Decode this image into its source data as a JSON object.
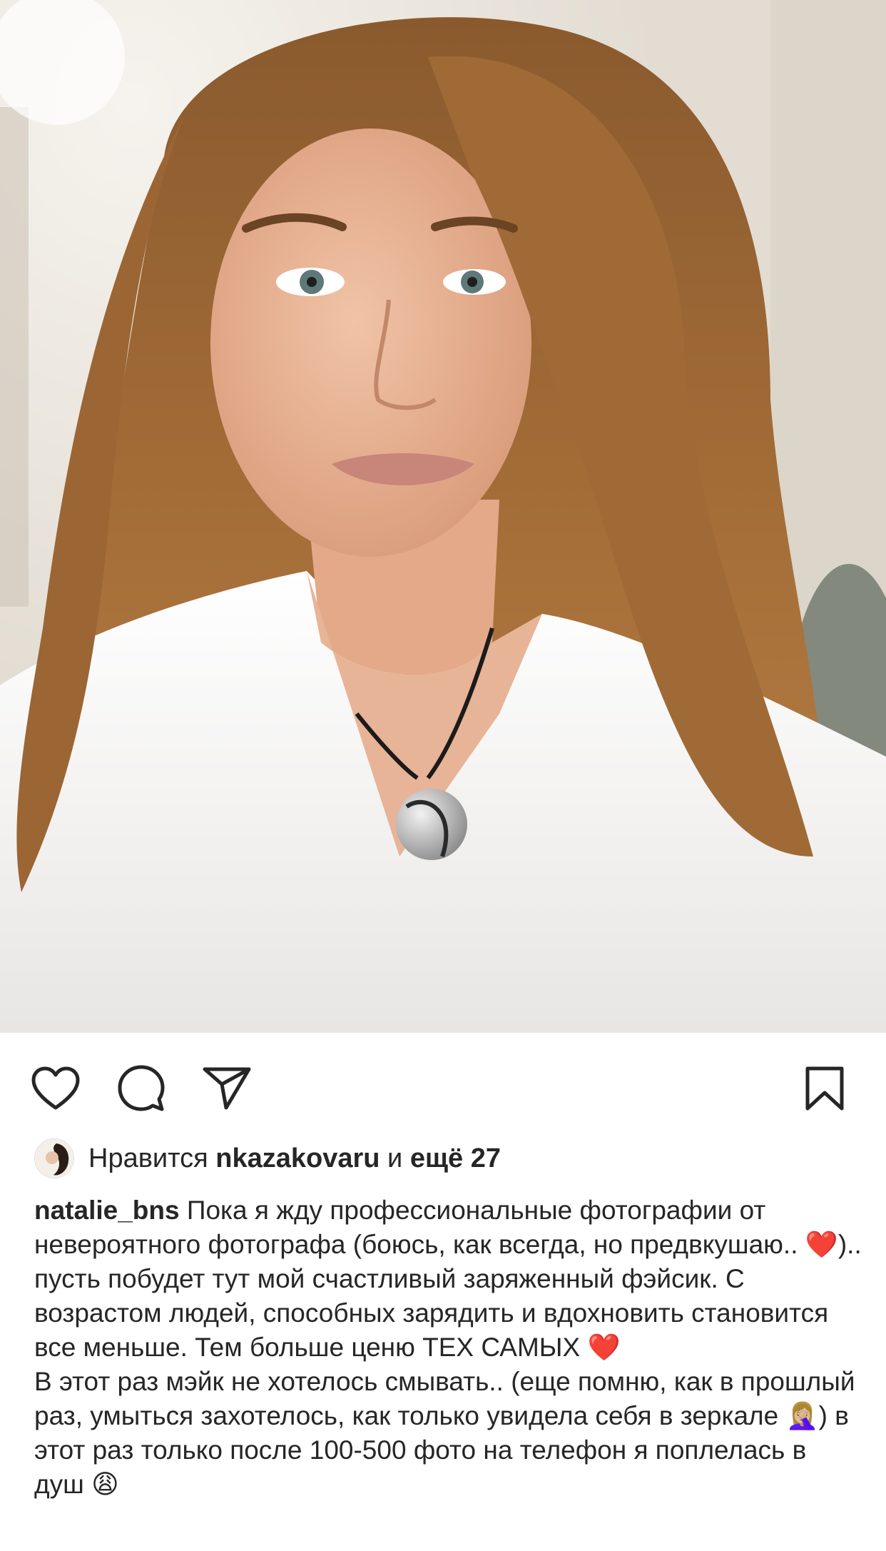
{
  "post": {
    "photo_alt": "selfie photo",
    "likes": {
      "prefix": "Нравится",
      "user": "nkazakovaru",
      "conjunction": "и",
      "others": "ещё 27"
    },
    "caption": {
      "username": "natalie_bns",
      "part1": "Пока я жду профессиональные фотографии от невероятного фотографа (боюсь, как всегда, но предвкушаю.. ",
      "heart1": "❤️",
      "part2": ").. пусть побудет тут мой счастливый заряженный фэйсик. С возрастом людей, способных зарядить и вдохновить становится все меньше. Тем больше ценю ТЕХ САМЫХ ",
      "heart2": "❤️",
      "para2_a": "В этот раз мэйк не хотелось смывать.. (еще помню, как в прошлый раз, умыться захотелось, как только увидела себя в зеркале ",
      "facepalm": "🤦🏼‍♀️",
      "para2_b": ") в этот раз только после 100-500 фото на телефон я поплелась в душ ",
      "weary": "😩"
    }
  },
  "icons": {
    "like": "heart-icon",
    "comment": "comment-icon",
    "share": "send-icon",
    "save": "bookmark-icon"
  }
}
